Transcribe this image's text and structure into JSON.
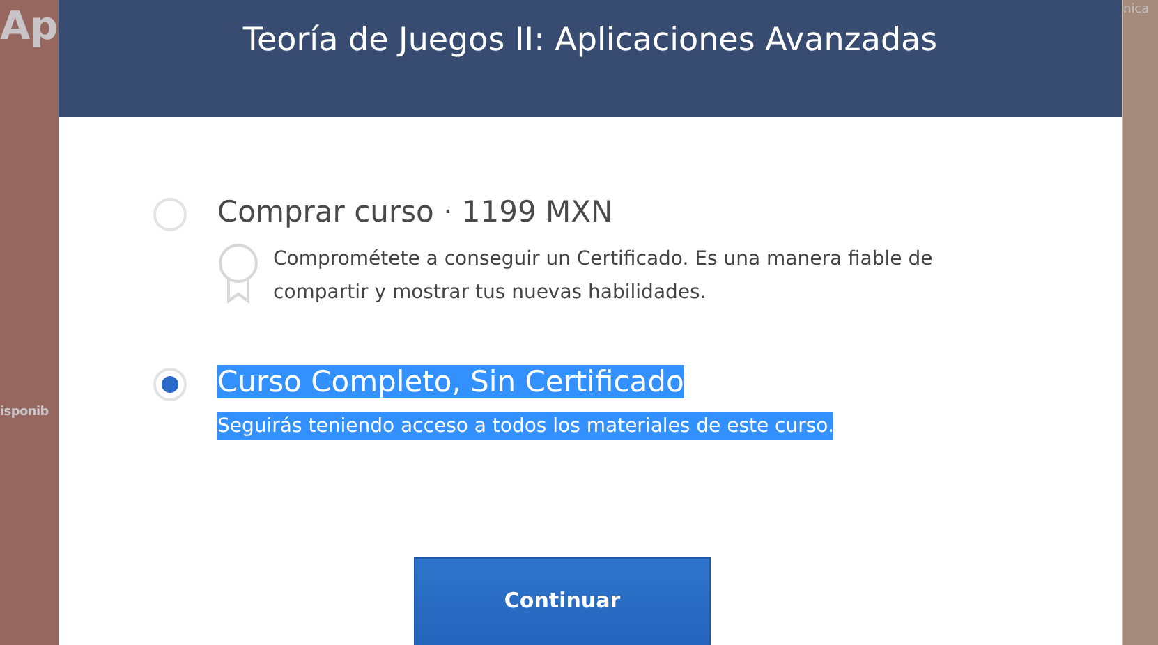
{
  "background": {
    "heading_fragment": "Ap",
    "left_fragment": "isponib",
    "right_fragment": "nica"
  },
  "dialog": {
    "title": "Teoría de Juegos II: Aplicaciones Avanzadas",
    "options": [
      {
        "label": "Comprar curso · 1199 MXN",
        "description": "Comprométete a conseguir un Certificado. Es una manera fiable de compartir y mostrar tus nuevas habilidades.",
        "kind": "certificate",
        "selected": false,
        "text_highlighted": false
      },
      {
        "label": "Curso Completo, Sin Certificado",
        "description": "Seguirás teniendo acceso a todos los materiales de este curso.",
        "kind": "plain",
        "selected": true,
        "text_highlighted": true
      }
    ],
    "button": "Continuar"
  }
}
